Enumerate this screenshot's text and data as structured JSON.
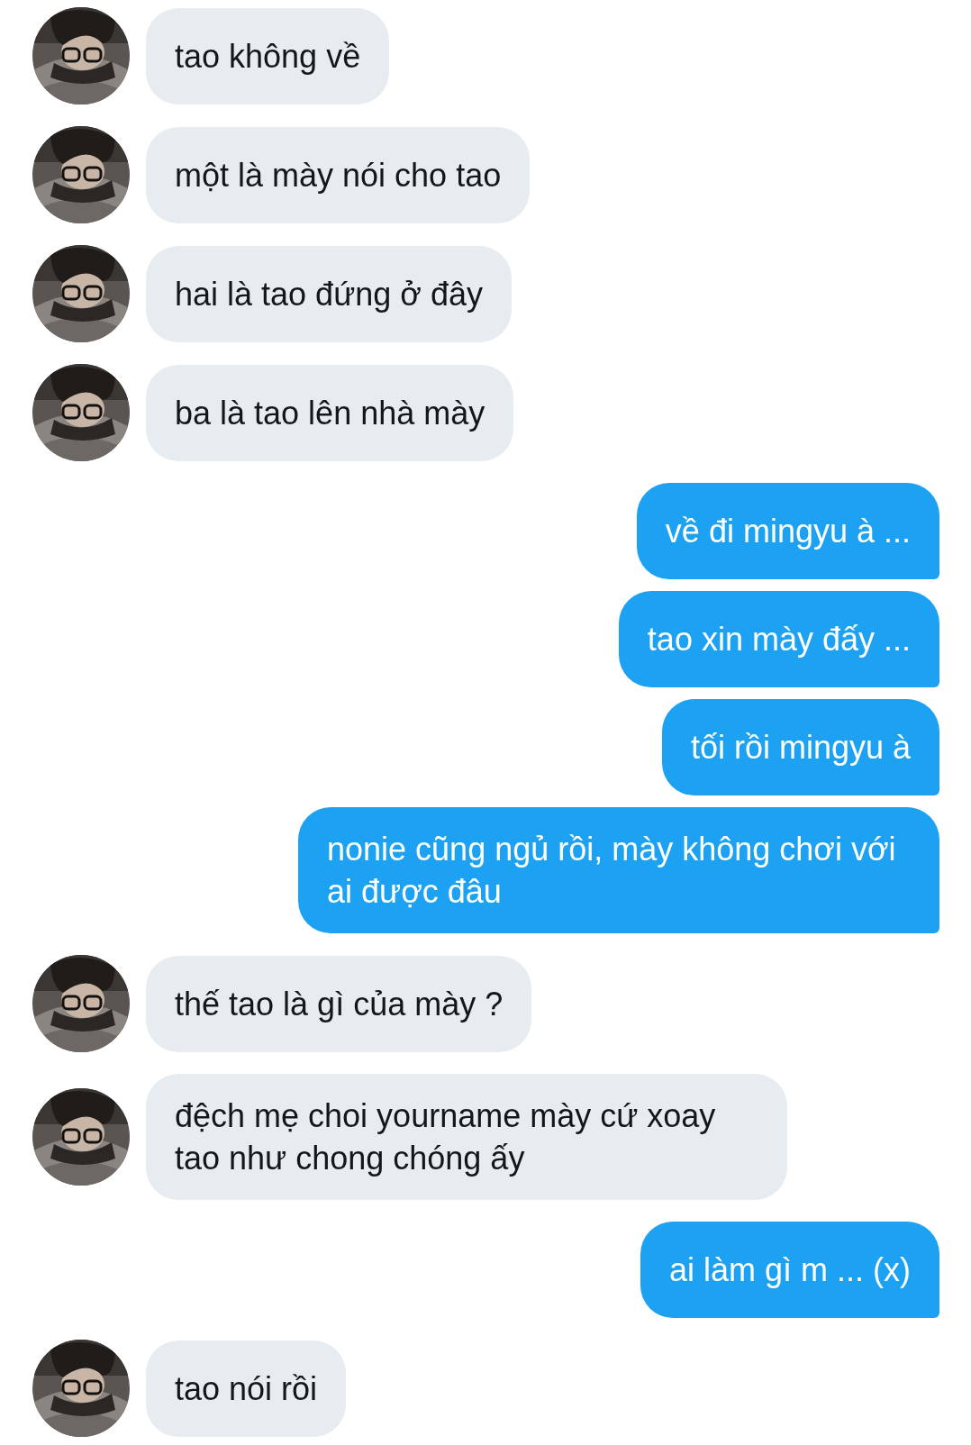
{
  "messages": [
    {
      "kind": "received",
      "text": "tao không về"
    },
    {
      "kind": "received",
      "text": "một là mày nói cho tao"
    },
    {
      "kind": "received",
      "text": "hai là tao đứng ở đây"
    },
    {
      "kind": "received",
      "text": "ba là tao lên nhà mày"
    },
    {
      "kind": "sent",
      "text": "về đi mingyu à ..."
    },
    {
      "kind": "sent",
      "text": "tao xin mày đấy ..."
    },
    {
      "kind": "sent",
      "text": "tối rồi mingyu à"
    },
    {
      "kind": "sent",
      "text": "nonie cũng ngủ rồi, mày không chơi với ai được đâu"
    },
    {
      "kind": "received",
      "text": "thế tao là gì của mày ?"
    },
    {
      "kind": "received",
      "text": "đệch mẹ choi yourname mày cứ xoay tao như chong chóng ấy"
    },
    {
      "kind": "sent",
      "text": "ai làm gì m ... (x)"
    },
    {
      "kind": "received",
      "text": "tao nói rồi"
    }
  ]
}
